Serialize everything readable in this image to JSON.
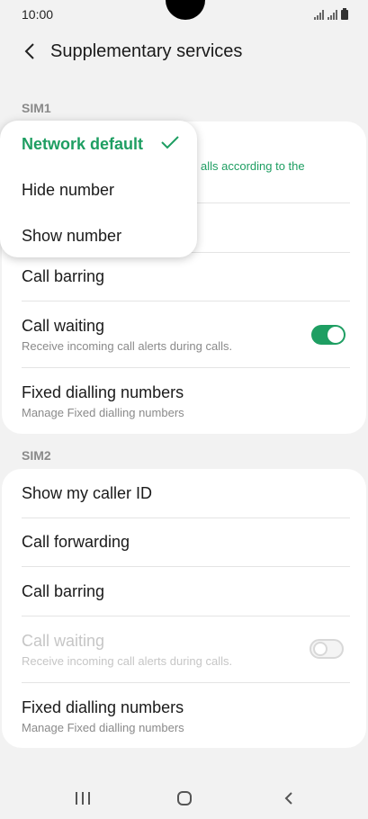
{
  "status": {
    "time": "10:00"
  },
  "header": {
    "title": "Supplementary services"
  },
  "sim1": {
    "label": "SIM1",
    "hidden_subtitle_fragment": "alls according to the",
    "items": [
      {
        "title": "Call barring"
      },
      {
        "title": "Call waiting",
        "subtitle": "Receive incoming call alerts during calls.",
        "toggle": "on"
      },
      {
        "title": "Fixed dialling numbers",
        "subtitle": "Manage Fixed dialling numbers"
      }
    ]
  },
  "popup": {
    "options": [
      {
        "label": "Network default",
        "selected": true
      },
      {
        "label": "Hide number",
        "selected": false
      },
      {
        "label": "Show number",
        "selected": false
      }
    ]
  },
  "sim2": {
    "label": "SIM2",
    "items": [
      {
        "title": "Show my caller ID"
      },
      {
        "title": "Call forwarding"
      },
      {
        "title": "Call barring"
      },
      {
        "title": "Call waiting",
        "subtitle": "Receive incoming call alerts during calls.",
        "toggle": "off",
        "disabled": true
      },
      {
        "title": "Fixed dialling numbers",
        "subtitle": "Manage Fixed dialling numbers"
      }
    ]
  },
  "colors": {
    "accent": "#1e9e62",
    "background": "#f2f2f2",
    "card": "#ffffff"
  },
  "navbar": {
    "icons": [
      "recent-apps-icon",
      "home-icon",
      "back-icon"
    ]
  }
}
